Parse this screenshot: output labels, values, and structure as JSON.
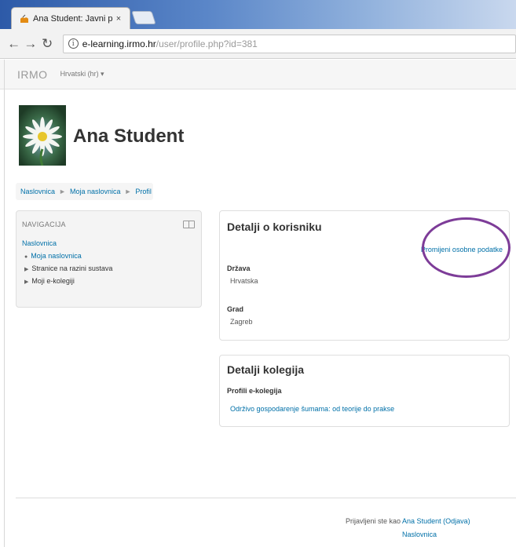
{
  "browser": {
    "tab_title": "Ana Student: Javni profil",
    "tab_close": "×",
    "url_host": "e-learning.irmo.hr",
    "url_path": "/user/profile.php?id=381"
  },
  "site": {
    "brand": "IRMO",
    "language": "Hrvatski (hr) ▾"
  },
  "profile": {
    "name": "Ana Student"
  },
  "breadcrumb": [
    "Naslovnica",
    "Moja naslovnica",
    "Profil"
  ],
  "navigation": {
    "header": "NAVIGACIJA",
    "root": "Naslovnica",
    "items": [
      {
        "label": "Moja naslovnica",
        "type": "link"
      },
      {
        "label": "Stranice na razini sustava",
        "type": "folder"
      },
      {
        "label": "Moji e-kolegiji",
        "type": "folder"
      }
    ]
  },
  "user_details": {
    "title": "Detalji o korisniku",
    "edit_link": "Promijeni osobne podatke",
    "fields": [
      {
        "label": "Država",
        "value": "Hrvatska"
      },
      {
        "label": "Grad",
        "value": "Zagreb"
      }
    ]
  },
  "course_details": {
    "title": "Detalji kolegija",
    "label": "Profili e-kolegija",
    "course": "Održivo gospodarenje šumama: od teorije do prakse"
  },
  "footer": {
    "logged_in_prefix": "Prijavljeni ste kao",
    "user_link": "Ana Student",
    "logout_link": "(Odjava)",
    "home_link": "Naslovnica"
  },
  "colors": {
    "link": "#0070a8",
    "highlight_circle": "#7d3c98"
  }
}
